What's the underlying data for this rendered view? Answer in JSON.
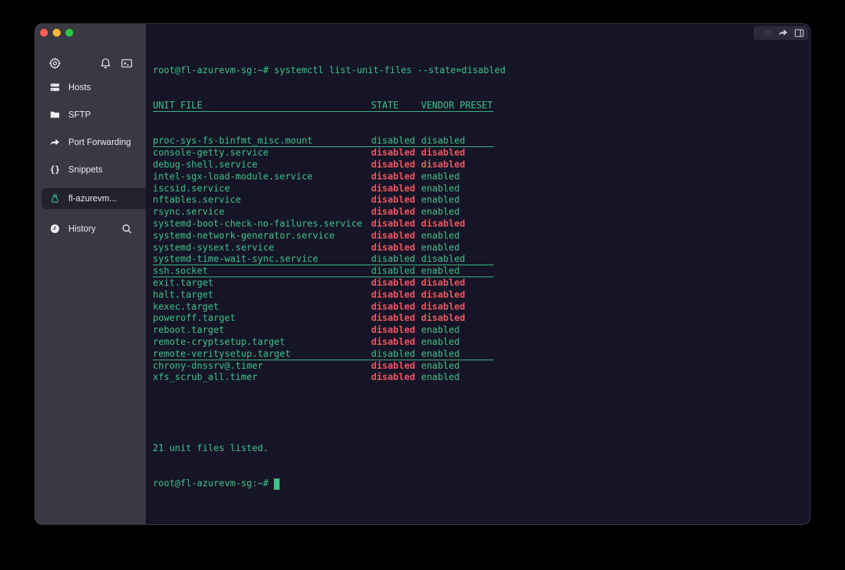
{
  "sidebar": {
    "items": [
      {
        "label": "Hosts",
        "icon": "server-icon"
      },
      {
        "label": "SFTP",
        "icon": "folder-icon"
      },
      {
        "label": "Port Forwarding",
        "icon": "forward-arrow-icon"
      },
      {
        "label": "Snippets",
        "icon": "braces-icon"
      },
      {
        "label": "fl-azurevm...",
        "icon": "linux-tux-icon",
        "active": true
      },
      {
        "label": "History",
        "icon": "clock-icon"
      }
    ]
  },
  "terminal": {
    "prompt": "root@fl-azurevm-sg:~# ",
    "command": "systemctl list-unit-files --state=disabled",
    "header": {
      "unit": "UNIT FILE",
      "state": "STATE",
      "vendor": "VENDOR PRESET"
    },
    "rows": [
      {
        "unit": "proc-sys-fs-binfmt_misc.mount",
        "state": "disabled",
        "vendor": "disabled",
        "style": "plain"
      },
      {
        "unit": "console-getty.service",
        "state": "disabled",
        "vendor": "disabled",
        "style": "red-red"
      },
      {
        "unit": "debug-shell.service",
        "state": "disabled",
        "vendor": "disabled",
        "style": "red-red"
      },
      {
        "unit": "intel-sgx-load-module.service",
        "state": "disabled",
        "vendor": "enabled",
        "style": "red-green"
      },
      {
        "unit": "iscsid.service",
        "state": "disabled",
        "vendor": "enabled",
        "style": "red-green"
      },
      {
        "unit": "nftables.service",
        "state": "disabled",
        "vendor": "enabled",
        "style": "red-green"
      },
      {
        "unit": "rsync.service",
        "state": "disabled",
        "vendor": "enabled",
        "style": "red-green"
      },
      {
        "unit": "systemd-boot-check-no-failures.service",
        "state": "disabled",
        "vendor": "disabled",
        "style": "red-red"
      },
      {
        "unit": "systemd-network-generator.service",
        "state": "disabled",
        "vendor": "enabled",
        "style": "red-green"
      },
      {
        "unit": "systemd-sysext.service",
        "state": "disabled",
        "vendor": "enabled",
        "style": "red-green"
      },
      {
        "unit": "systemd-time-wait-sync.service",
        "state": "disabled",
        "vendor": "disabled",
        "style": "plain"
      },
      {
        "unit": "ssh.socket",
        "state": "disabled",
        "vendor": "enabled",
        "style": "plain"
      },
      {
        "unit": "exit.target",
        "state": "disabled",
        "vendor": "disabled",
        "style": "red-red"
      },
      {
        "unit": "halt.target",
        "state": "disabled",
        "vendor": "disabled",
        "style": "red-red"
      },
      {
        "unit": "kexec.target",
        "state": "disabled",
        "vendor": "disabled",
        "style": "red-red"
      },
      {
        "unit": "poweroff.target",
        "state": "disabled",
        "vendor": "disabled",
        "style": "red-red"
      },
      {
        "unit": "reboot.target",
        "state": "disabled",
        "vendor": "enabled",
        "style": "red-green"
      },
      {
        "unit": "remote-cryptsetup.target",
        "state": "disabled",
        "vendor": "enabled",
        "style": "red-green"
      },
      {
        "unit": "remote-veritysetup.target",
        "state": "disabled",
        "vendor": "enabled",
        "style": "plain"
      },
      {
        "unit": "chrony-dnssrv@.timer",
        "state": "disabled",
        "vendor": "enabled",
        "style": "red-green"
      },
      {
        "unit": "xfs_scrub_all.timer",
        "state": "disabled",
        "vendor": "enabled",
        "style": "red-green"
      }
    ],
    "summary": "21 unit files listed.",
    "final_prompt": "root@fl-azurevm-sg:~# "
  },
  "colors": {
    "terminal_bg": "#161527",
    "sidebar_bg": "#3a3943",
    "green": "#3ec289",
    "red": "#f0555f"
  }
}
